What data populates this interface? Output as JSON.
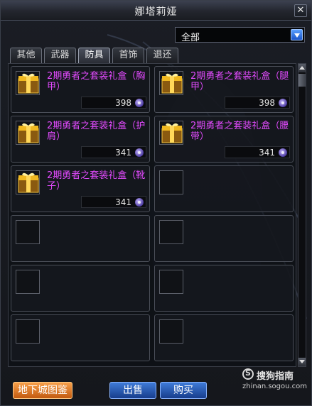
{
  "window": {
    "title": "娜塔莉娅"
  },
  "filter": {
    "selected": "全部"
  },
  "tabs": [
    {
      "label": "其他"
    },
    {
      "label": "武器"
    },
    {
      "label": "防具"
    },
    {
      "label": "首饰"
    },
    {
      "label": "退还"
    }
  ],
  "active_tab": "防具",
  "items": [
    {
      "name": "2期勇者之套装礼盒（胸甲）",
      "price": "398",
      "icon": "gift-box-icon"
    },
    {
      "name": "2期勇者之套装礼盒（腿甲）",
      "price": "398",
      "icon": "gift-box-icon"
    },
    {
      "name": "2期勇者之套装礼盒（护肩）",
      "price": "341",
      "icon": "gift-box-icon"
    },
    {
      "name": "2期勇者之套装礼盒（腰带）",
      "price": "341",
      "icon": "gift-box-icon"
    },
    {
      "name": "2期勇者之套装礼盒（靴子）",
      "price": "341",
      "icon": "gift-box-icon"
    }
  ],
  "buttons": {
    "dungeon": "地下城图鉴",
    "sell": "出售",
    "buy": "购买"
  },
  "watermark": {
    "brand": "搜狗指南",
    "url": "zhinan.sogou.com"
  },
  "colors": {
    "item_name": "#e34bff",
    "accent_blue": "#2a6ad0",
    "accent_orange": "#e07a24"
  }
}
